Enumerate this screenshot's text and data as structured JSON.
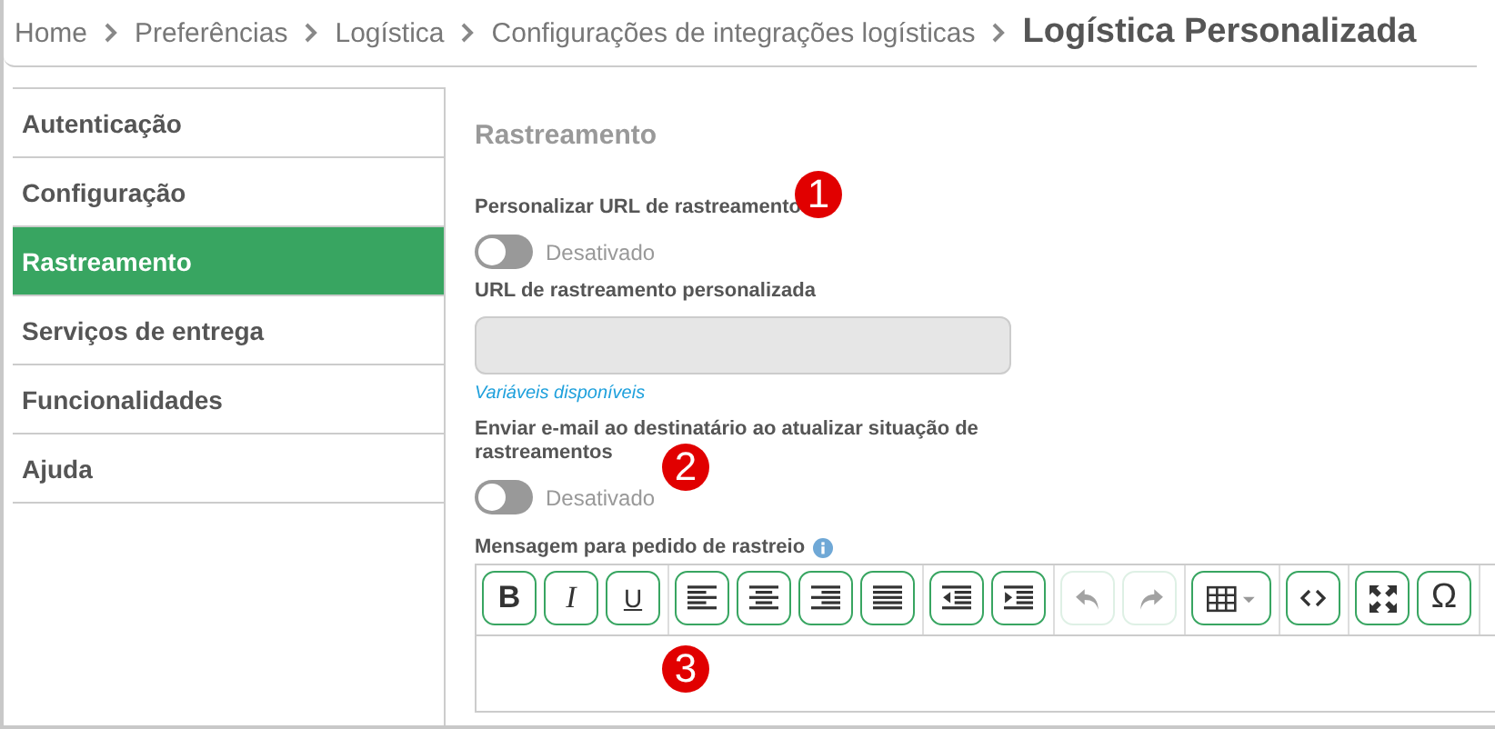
{
  "breadcrumb": {
    "items": [
      "Home",
      "Preferências",
      "Logística",
      "Configurações de integrações logísticas"
    ],
    "current": "Logística Personalizada"
  },
  "sidebar": {
    "items": [
      {
        "label": "Autenticação",
        "selected": false
      },
      {
        "label": "Configuração",
        "selected": false
      },
      {
        "label": "Rastreamento",
        "selected": true
      },
      {
        "label": "Serviços de entrega",
        "selected": false
      },
      {
        "label": "Funcionalidades",
        "selected": false
      },
      {
        "label": "Ajuda",
        "selected": false
      }
    ]
  },
  "section_title": "Rastreamento",
  "fields": [
    {
      "kind": "toggle",
      "label": "Personalizar URL de rastreamento",
      "on": false,
      "state_text": "Desativado",
      "marker": "1"
    },
    {
      "kind": "text",
      "label": "URL de rastreamento personalizada",
      "disabled": true,
      "link": "Variáveis disponíveis"
    },
    {
      "kind": "toggle",
      "label": "Enviar e-mail ao destinatário ao atualizar situação de rastreamentos",
      "on": false,
      "state_text": "Desativado",
      "marker": "2"
    },
    {
      "kind": "editor",
      "label": "Mensagem para pedido de rastreio",
      "info": true,
      "marker": "3",
      "toolbar": [
        [
          {
            "kind": "bold",
            "label": "B",
            "disabled": false
          },
          {
            "kind": "italic",
            "label": "I",
            "disabled": false
          },
          {
            "kind": "underline",
            "label": "U",
            "disabled": false
          }
        ],
        [
          {
            "kind": "align-left",
            "disabled": false
          },
          {
            "kind": "align-center",
            "disabled": false
          },
          {
            "kind": "align-right",
            "disabled": false
          },
          {
            "kind": "justify",
            "disabled": false
          }
        ],
        [
          {
            "kind": "outdent",
            "disabled": false
          },
          {
            "kind": "indent",
            "disabled": false
          }
        ],
        [
          {
            "kind": "undo",
            "disabled": true
          },
          {
            "kind": "redo",
            "disabled": true
          }
        ],
        [
          {
            "kind": "table",
            "disabled": false
          }
        ],
        [
          {
            "kind": "code",
            "disabled": false
          }
        ],
        [
          {
            "kind": "fullscreen",
            "disabled": false
          },
          {
            "kind": "special-char",
            "label": "Ω",
            "disabled": false
          }
        ]
      ]
    }
  ]
}
